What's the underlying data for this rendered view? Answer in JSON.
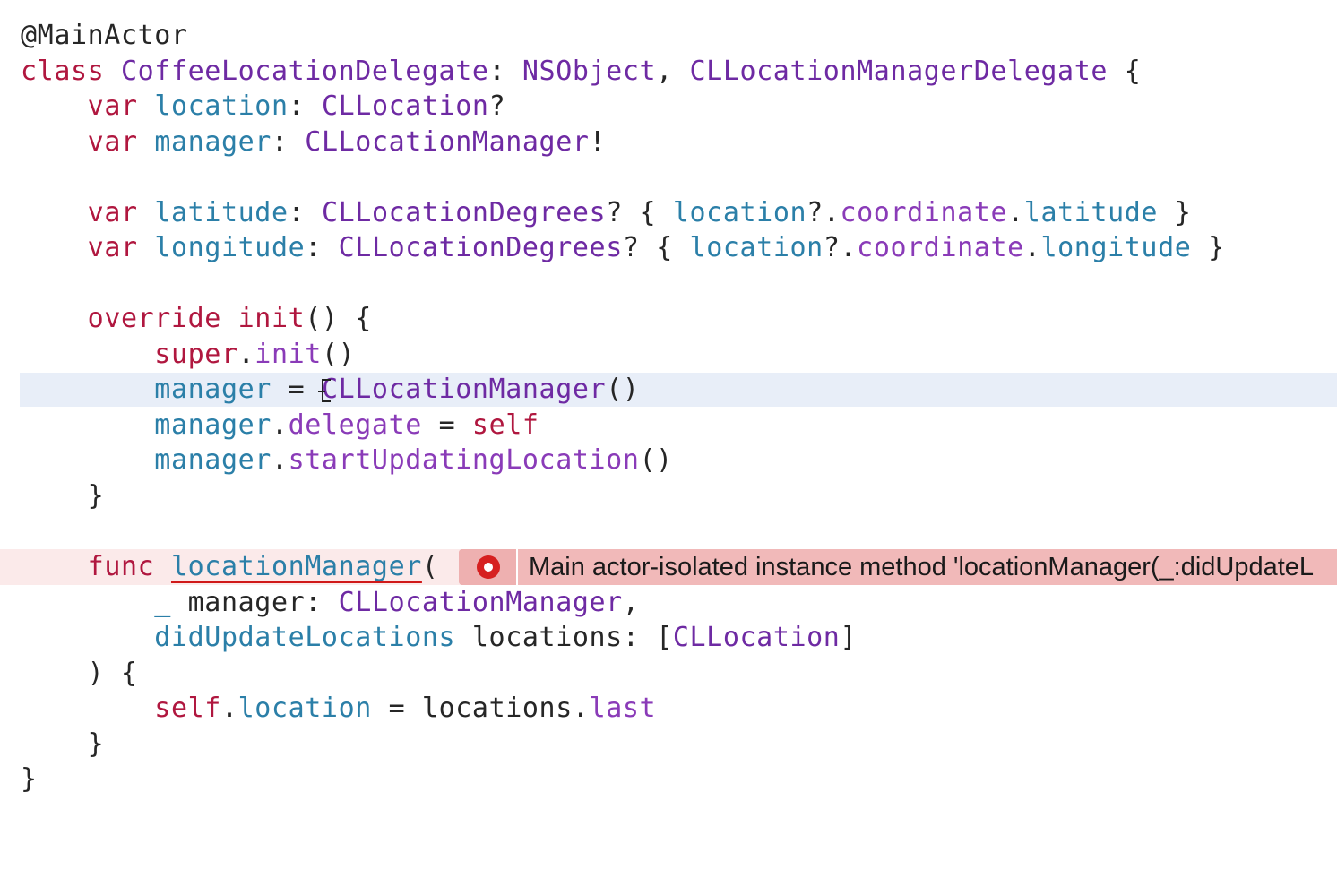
{
  "colors": {
    "keyword": "#b0173f",
    "type": "#6e2aa3",
    "variable": "#2b7fa8",
    "property": "#8a3bb8",
    "plain": "#262626",
    "current_line": "#e8eef8",
    "error_banner": "#f1b9b9",
    "error_icon": "#d62020"
  },
  "code": {
    "l1": {
      "attr": "@MainActor"
    },
    "l2": {
      "kw": "class",
      "name": "CoffeeLocationDelegate",
      "colon": ": ",
      "super": "NSObject",
      "comma": ", ",
      "proto": "CLLocationManagerDelegate",
      "brace": " {"
    },
    "l3": {
      "kw": "var",
      "name": "location",
      "colon": ": ",
      "type": "CLLocation",
      "opt": "?"
    },
    "l4": {
      "kw": "var",
      "name": "manager",
      "colon": ": ",
      "type": "CLLocationManager",
      "opt": "!"
    },
    "l6": {
      "kw": "var",
      "name": "latitude",
      "colon": ": ",
      "type": "CLLocationDegrees",
      "open": "? { ",
      "base": "location",
      "chain": "?.",
      "p1": "coordinate",
      "dot": ".",
      "p2": "latitude",
      "close": " }"
    },
    "l7": {
      "kw": "var",
      "name": "longitude",
      "colon": ": ",
      "type": "CLLocationDegrees",
      "open": "? { ",
      "base": "location",
      "chain": "?.",
      "p1": "coordinate",
      "dot": ".",
      "p2": "longitude",
      "close": " }"
    },
    "l9": {
      "kw1": "override",
      "kw2": "init",
      "rest": "() {"
    },
    "l10": {
      "kw": "super",
      "dot": ".",
      "fn": "init",
      "rest": "()"
    },
    "l11": {
      "var": "manager",
      "eq": " = ",
      "type": "CLLocationManager",
      "rest": "()"
    },
    "l12": {
      "var": "manager",
      "dot": ".",
      "prop": "delegate",
      "eq": " = ",
      "kw": "self"
    },
    "l13": {
      "var": "manager",
      "dot": ".",
      "fn": "startUpdatingLocation",
      "rest": "()"
    },
    "l14": {
      "brace": "}"
    },
    "l16": {
      "kw": "func",
      "name": "locationManager",
      "rest": "("
    },
    "l17": {
      "label": "_",
      "param": " manager",
      "colon": ": ",
      "type": "CLLocationManager",
      "comma": ","
    },
    "l18": {
      "label": "didUpdateLocations",
      "param": " locations",
      "colon": ": ",
      "open": "[",
      "type": "CLLocation",
      "close": "]"
    },
    "l19": {
      "text": ") {"
    },
    "l20": {
      "kw": "self",
      "dot": ".",
      "prop": "location",
      "eq": " = ",
      "var": "locations",
      "dot2": ".",
      "last": "last"
    },
    "l21": {
      "brace": "}"
    },
    "l22": {
      "brace": "}"
    }
  },
  "error": {
    "icon": "error-icon",
    "message": "Main actor-isolated instance method 'locationManager(_:didUpdateL"
  }
}
